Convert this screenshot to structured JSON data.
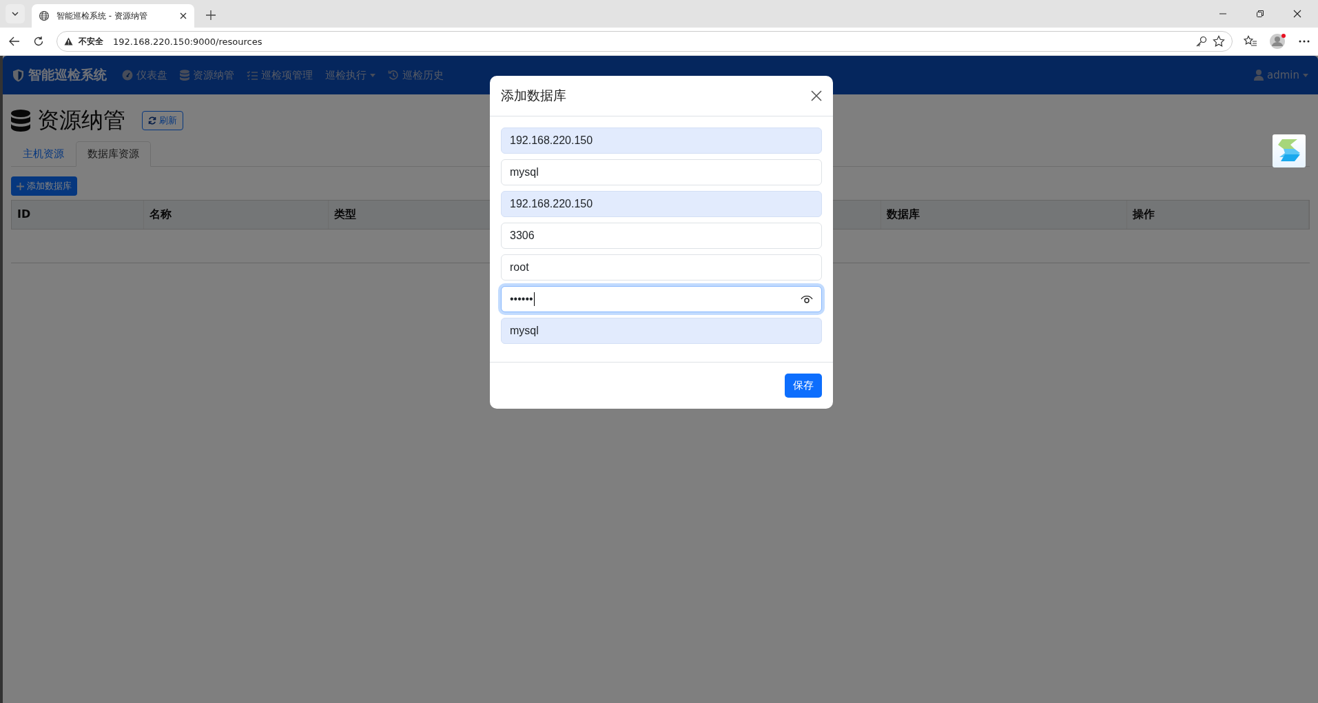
{
  "browser": {
    "tab_title": "智能巡检系统 - 资源纳管",
    "security_label": "不安全",
    "url": "192.168.220.150:9000/resources"
  },
  "navbar": {
    "brand": "智能巡检系统",
    "items": [
      {
        "label": "仪表盘",
        "dropdown": false
      },
      {
        "label": "资源纳管",
        "dropdown": false
      },
      {
        "label": "巡检项管理",
        "dropdown": false
      },
      {
        "label": "巡检执行",
        "dropdown": true
      },
      {
        "label": "巡检历史",
        "dropdown": false
      }
    ],
    "user": "admin"
  },
  "page": {
    "title": "资源纳管",
    "refresh_button": "刷新",
    "tabs": [
      {
        "label": "主机资源",
        "selected": false
      },
      {
        "label": "数据库资源",
        "selected": true
      }
    ],
    "add_button": "添加数据库",
    "table": {
      "columns": [
        "ID",
        "名称",
        "类型",
        "数据库",
        "操作"
      ]
    }
  },
  "modal": {
    "title": "添加数据库",
    "fields": [
      {
        "kind": "text",
        "value": "192.168.220.150",
        "autofilled": true,
        "focused": false
      },
      {
        "kind": "text",
        "value": "mysql",
        "autofilled": false,
        "focused": false
      },
      {
        "kind": "text",
        "value": "192.168.220.150",
        "autofilled": true,
        "focused": false
      },
      {
        "kind": "text",
        "value": "3306",
        "autofilled": false,
        "focused": false
      },
      {
        "kind": "text",
        "value": "root",
        "autofilled": false,
        "focused": false
      },
      {
        "kind": "password",
        "value": "••••••",
        "autofilled": false,
        "focused": true
      },
      {
        "kind": "text",
        "value": "mysql",
        "autofilled": true,
        "focused": false
      }
    ],
    "save_button": "保存"
  }
}
